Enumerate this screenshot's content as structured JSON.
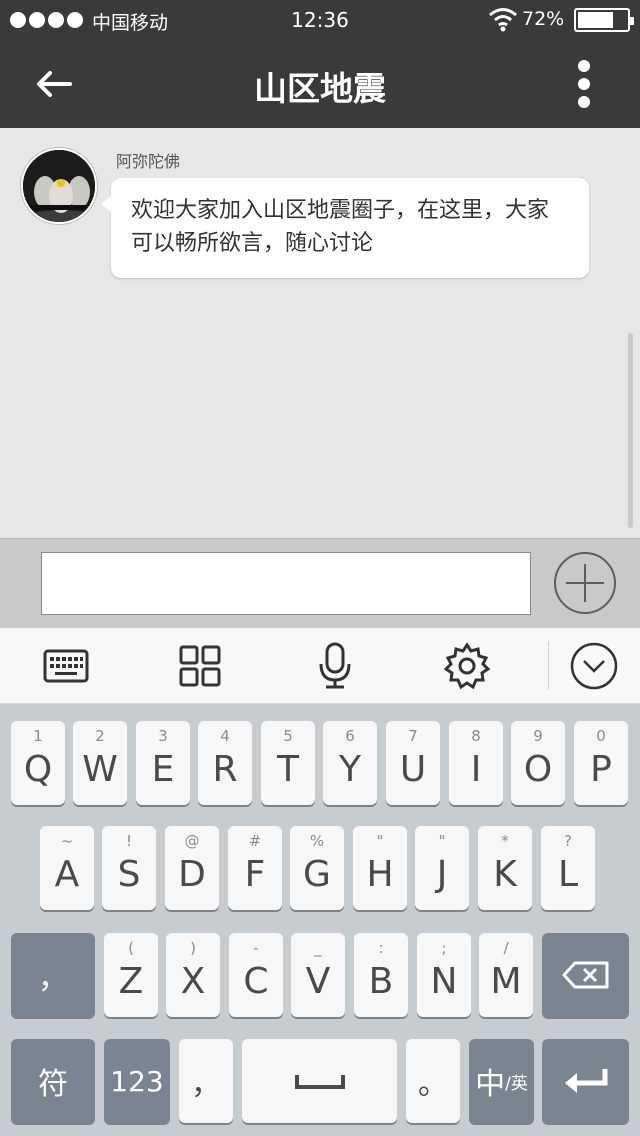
{
  "status_bar": {
    "carrier": "中国移动",
    "time": "12:36",
    "battery_percent_label": "72%",
    "battery_level": 0.72
  },
  "header": {
    "title": "山区地震",
    "back_icon": "arrow-left-icon",
    "more_icon": "more-vertical-icon"
  },
  "chat": {
    "messages": [
      {
        "sender": "阿弥陀佛",
        "text": "欢迎大家加入山区地震圈子，在这里，大家可以畅所欲言，随心讨论"
      }
    ]
  },
  "composer": {
    "value": "",
    "plus_icon": "plus-circle-icon"
  },
  "keyboard_toolbar": {
    "icons": [
      "keyboard-icon",
      "grid-icon",
      "microphone-icon",
      "gear-icon",
      "chevron-down-icon"
    ]
  },
  "keyboard": {
    "row1": [
      {
        "hint": "1",
        "key": "Q"
      },
      {
        "hint": "2",
        "key": "W"
      },
      {
        "hint": "3",
        "key": "E"
      },
      {
        "hint": "4",
        "key": "R"
      },
      {
        "hint": "5",
        "key": "T"
      },
      {
        "hint": "6",
        "key": "Y"
      },
      {
        "hint": "7",
        "key": "U"
      },
      {
        "hint": "8",
        "key": "I"
      },
      {
        "hint": "9",
        "key": "O"
      },
      {
        "hint": "0",
        "key": "P"
      }
    ],
    "row2": [
      {
        "hint": "~",
        "key": "A"
      },
      {
        "hint": "!",
        "key": "S"
      },
      {
        "hint": "@",
        "key": "D"
      },
      {
        "hint": "#",
        "key": "F"
      },
      {
        "hint": "%",
        "key": "G"
      },
      {
        "hint": "\"",
        "key": "H"
      },
      {
        "hint": "\"",
        "key": "J"
      },
      {
        "hint": "*",
        "key": "K"
      },
      {
        "hint": "?",
        "key": "L"
      }
    ],
    "row3": [
      {
        "hint": "(",
        "key": "Z"
      },
      {
        "hint": ")",
        "key": "X"
      },
      {
        "hint": "-",
        "key": "C"
      },
      {
        "hint": "_",
        "key": "V"
      },
      {
        "hint": ":",
        "key": "B"
      },
      {
        "hint": ";",
        "key": "N"
      },
      {
        "hint": "/",
        "key": "M"
      }
    ],
    "row3_left": "，",
    "backspace_icon": "backspace-icon",
    "symbols_key": "符",
    "numbers_key": "123",
    "comma_key": "，",
    "period_key": "。",
    "lang_key_main": "中",
    "lang_key_sub": "/英",
    "enter_icon": "enter-icon"
  }
}
